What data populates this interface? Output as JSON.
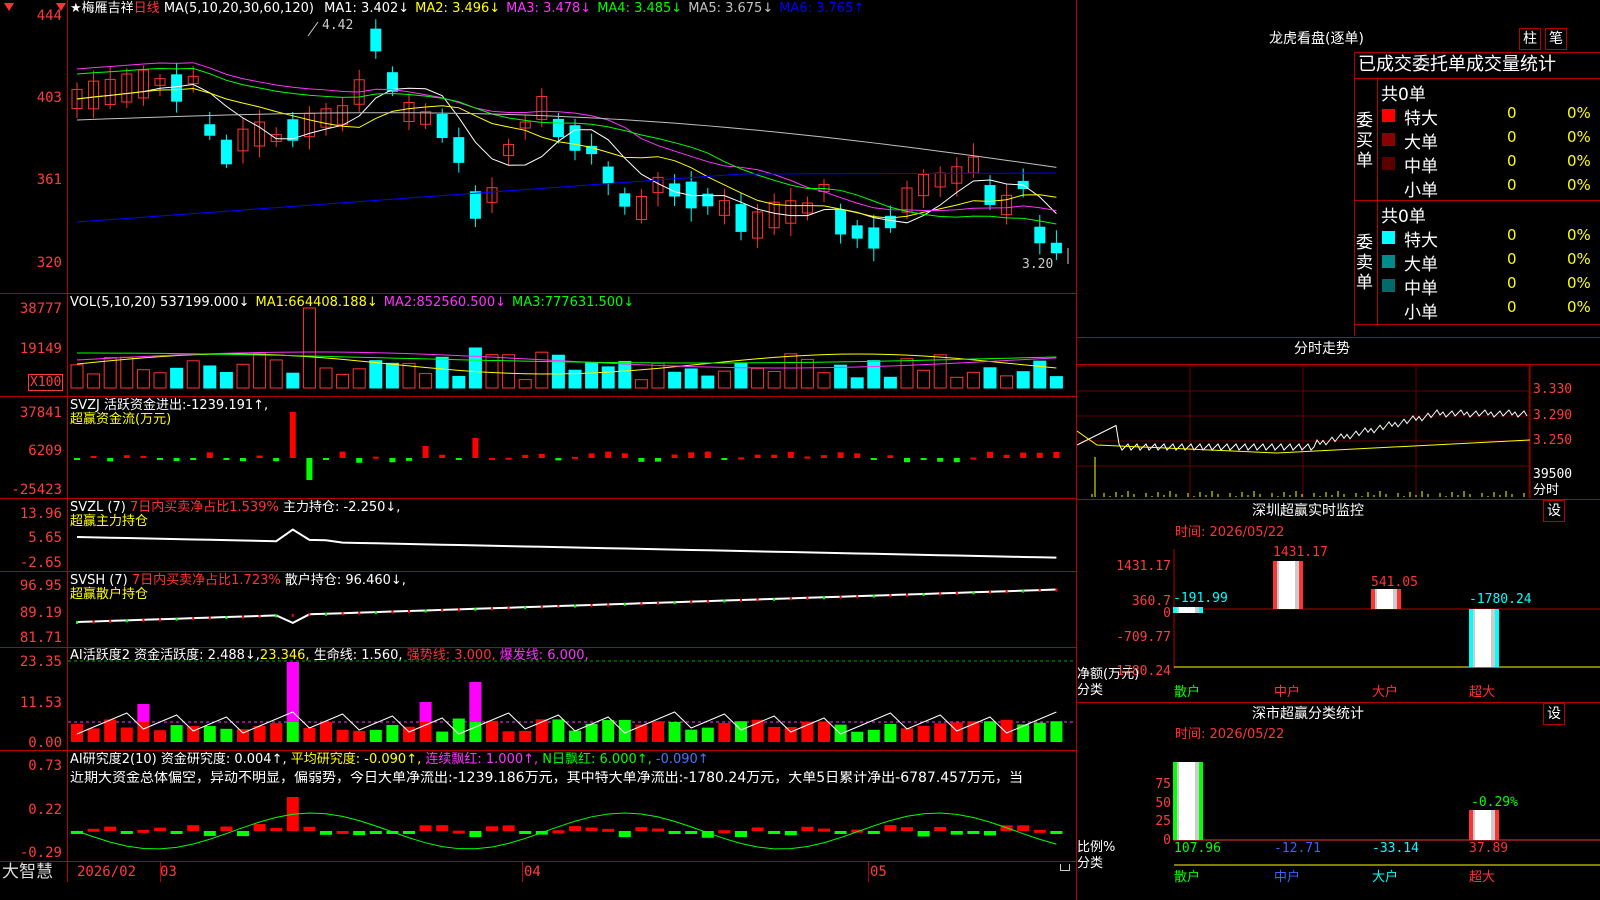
{
  "main": {
    "star": "★",
    "stock_name": "梅雁吉祥",
    "period": "日线",
    "ma_def": "MA(5,10,20,30,60,120)",
    "ma": [
      {
        "label": "MA1:",
        "value": "3.402↓",
        "color": "#ffffff"
      },
      {
        "label": "MA2:",
        "value": "3.496↓",
        "color": "#ffff00"
      },
      {
        "label": "MA3:",
        "value": "3.478↓",
        "color": "#ff33ff"
      },
      {
        "label": "MA4:",
        "value": "3.485↓",
        "color": "#00ff00"
      },
      {
        "label": "MA5:",
        "value": "3.675↓",
        "color": "#c0c0c0"
      },
      {
        "label": "MA6:",
        "value": "3.765↑",
        "color": "#0000ff"
      }
    ],
    "y_ticks": [
      "444",
      "403",
      "361",
      "320"
    ],
    "high_label": "4.42",
    "low_label": "3.20"
  },
  "vol": {
    "def": "VOL(5,10,20)",
    "value": "537199.000↓",
    "ma": [
      {
        "t": "MA1:",
        "v": "664408.188↓",
        "c": "#ffff00"
      },
      {
        "t": "MA2:",
        "v": "852560.500↓",
        "c": "#ff33ff"
      },
      {
        "t": "MA3:",
        "v": "777631.500↓",
        "c": "#00ff00"
      }
    ],
    "y_ticks": [
      "38777",
      "19149"
    ],
    "unit": "X100"
  },
  "svzj": {
    "name": "SVZJ",
    "l1": "活跃资金进出:",
    "v1": "-1239.191↑,",
    "l2": "超赢资金流(万元)",
    "y_ticks": [
      "37841",
      "6209",
      "-25423"
    ]
  },
  "svzl": {
    "name": "SVZL (7)",
    "l1": "7日内买卖净占比1.539%",
    "l2": "主力持仓:",
    "v2": "-2.250↓,",
    "l3": "超赢主力持仓",
    "y_ticks": [
      "13.96",
      "5.65",
      "-2.65"
    ]
  },
  "svsh": {
    "name": "SVSH (7)",
    "l1": "7日内买卖净占比1.723%",
    "l2": "散户持仓:",
    "v2": "96.460↓,",
    "l3": "超赢散户持仓",
    "y_ticks": [
      "96.95",
      "89.19",
      "81.71"
    ]
  },
  "ai1": {
    "name": "AI活跃度2",
    "l1": "资金活跃度:",
    "v1": "2.488↓,",
    "v2": "23.346,",
    "l3": "生命线:",
    "v3": "1.560,",
    "l4": "强势线:",
    "v4": "3.000,",
    "l5": "爆发线:",
    "v5": "6.000,",
    "y_ticks": [
      "23.35",
      "11.53",
      "0.00"
    ]
  },
  "ai2": {
    "name": "AI研究度2(10)",
    "l1": "资金研究度:",
    "v1": "0.004↑,",
    "l2": "平均研究度:",
    "v2": "-0.090↑,",
    "l3": "连续飘红:",
    "v3": "1.000↑,",
    "l4": "N日飘红:",
    "v4": "6.000↑,",
    "v5": "-0.090↑",
    "comment": "近期大资金总体偏空，异动不明显，偏弱势，今日大单净流出:-1239.186万元，其中特大单净流出:-1780.24万元，大单5日累计净出-6787.457万元，当",
    "y_ticks": [
      "0.73",
      "0.22",
      "-0.29"
    ]
  },
  "footer": {
    "logo": "大智慧",
    "dates": [
      "2026/02",
      "03",
      "04",
      "05"
    ]
  },
  "lhb": {
    "title": "龙虎看盘(逐单)",
    "btn1": "柱",
    "btn2": "笔",
    "subtitle": "已成交委托单成交量统计",
    "buy": {
      "side": [
        "委",
        "买",
        "单"
      ],
      "total": "共0单",
      "rows": [
        {
          "label": "特大",
          "c": "#ff0000",
          "n": "0",
          "p": "0%"
        },
        {
          "label": "大单",
          "c": "#8b0000",
          "n": "0",
          "p": "0%"
        },
        {
          "label": "中单",
          "c": "#5a0000",
          "n": "0",
          "p": "0%"
        },
        {
          "label": "小单",
          "c": "#000000",
          "n": "0",
          "p": "0%"
        }
      ]
    },
    "sell": {
      "side": [
        "委",
        "卖",
        "单"
      ],
      "total": "共0单",
      "rows": [
        {
          "label": "特大",
          "c": "#00ffff",
          "n": "0",
          "p": "0%"
        },
        {
          "label": "大单",
          "c": "#008b8b",
          "n": "0",
          "p": "0%"
        },
        {
          "label": "中单",
          "c": "#006a6a",
          "n": "0",
          "p": "0%"
        },
        {
          "label": "小单",
          "c": "#000000",
          "n": "0",
          "p": "0%"
        }
      ]
    }
  },
  "fenshi": {
    "title": "分时走势",
    "y_ticks": [
      "3.330",
      "3.290",
      "3.250"
    ],
    "vol_tick": "39500",
    "unit": "分时"
  },
  "monitor": {
    "title": "深圳超赢实时监控",
    "btn": "设",
    "time": "时间: 2026/05/22",
    "y_ticks": [
      "1431.17",
      "360.7",
      "0",
      "-709.77",
      "-1780.24"
    ],
    "ylabel": "净额(万元)",
    "xlabel": "分类",
    "cats": [
      "散户",
      "中户",
      "大户",
      "超大"
    ],
    "values": [
      "-191.99",
      "1431.17",
      "541.05",
      "-1780.24"
    ]
  },
  "stats": {
    "title": "深市超赢分类统计",
    "btn": "设",
    "time": "时间: 2026/05/22",
    "y_ticks": [
      "75",
      "50",
      "25",
      "0"
    ],
    "ylabel": "比例%",
    "xlabel": "分类",
    "cats": [
      "散户",
      "中户",
      "大户",
      "超大"
    ],
    "values": [
      "107.96",
      "-12.71",
      "-33.14",
      "37.89"
    ],
    "top_label": "-0.29%"
  }
}
